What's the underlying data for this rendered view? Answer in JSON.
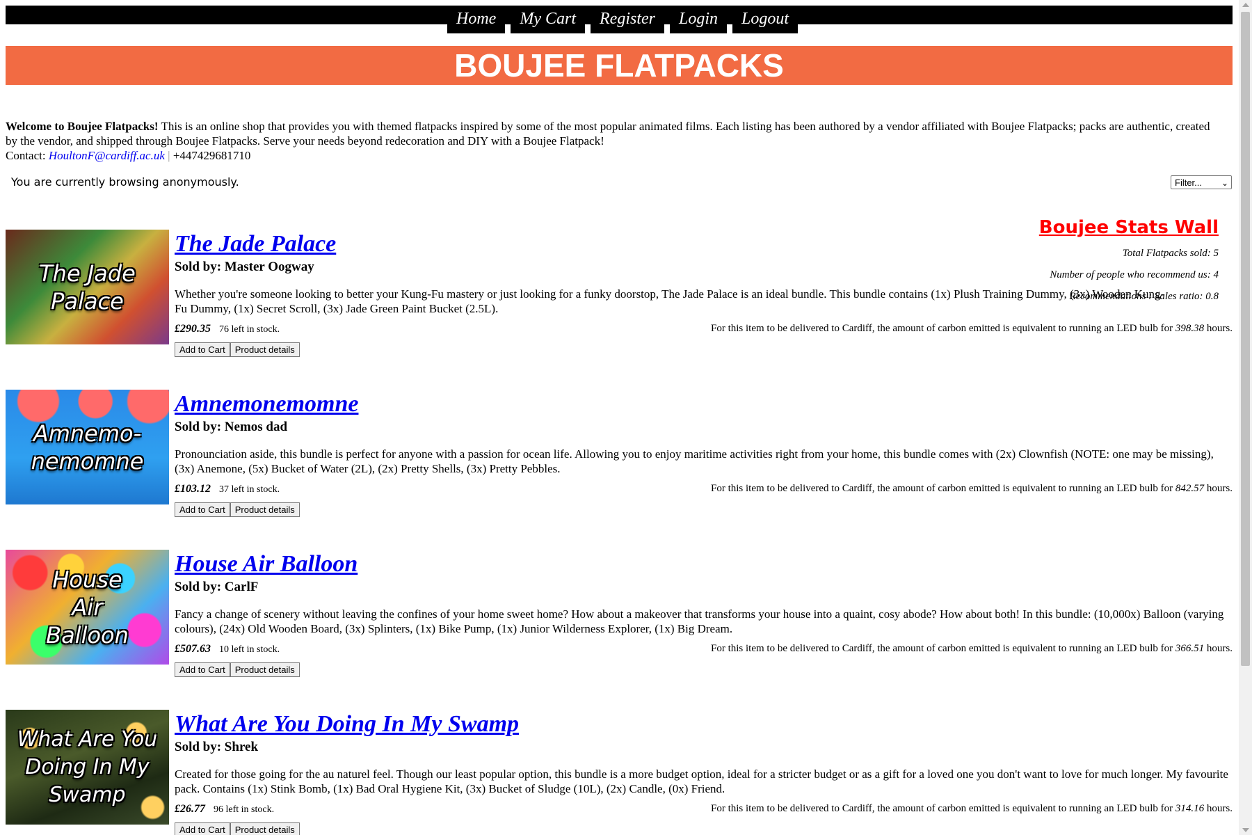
{
  "nav": {
    "items": [
      "Home",
      "My Cart",
      "Register",
      "Login",
      "Logout"
    ]
  },
  "banner": {
    "title": "BOUJEE FLATPACKS"
  },
  "intro": {
    "welcome": "Welcome to Boujee Flatpacks!",
    "text": " This is an online shop that provides you with themed flatpacks inspired by some of the most popular animated films. Each listing has been authored by a vendor affiliated with Boujee Flatpacks; packs are authentic, created by the vendor, and shipped through Boujee Flatpacks. Serve your needs beyond redecoration and DIY with a Boujee Flatpack!",
    "contact_label": "Contact: ",
    "email": "HoultonF@cardiff.ac.uk",
    "separator": " | ",
    "phone": "+447429681710"
  },
  "browsing": "You are currently browsing anonymously.",
  "filter": {
    "selected": "Filter..."
  },
  "stats": {
    "title": "Boujee Stats Wall",
    "lines": [
      "Total Flatpacks sold: 5",
      "Number of people who recommend us: 4",
      "Recommendations : Sales ratio: 0.8"
    ]
  },
  "common": {
    "carbon_prefix": "For this item to be delivered to Cardiff, the amount of carbon emitted is equivalent to running an LED bulb for ",
    "carbon_suffix": " hours.",
    "add_to_cart": "Add to Cart",
    "product_details": "Product details",
    "stock_suffix": " left in stock."
  },
  "products": [
    {
      "title": "The Jade Palace",
      "thumb_lines": [
        "The Jade",
        "Palace"
      ],
      "seller": "Sold by: Master Oogway",
      "description": "Whether you're someone looking to better your Kung-Fu mastery or just looking for a funky doorstop, The Jade Palace is an ideal bundle. This bundle contains (1x) Plush Training Dummy, (3x) Wooden Kung-Fu Dummy, (1x) Secret Scroll, (3x) Jade Green Paint Bucket (2.5L).",
      "price": "£290.35",
      "stock": "76",
      "carbon_hours": "398.38"
    },
    {
      "title": "Amnemonemomne",
      "thumb_lines": [
        "Amnemo-",
        "nemomne"
      ],
      "seller": "Sold by: Nemos dad",
      "description": "Pronounciation aside, this bundle is perfect for anyone with a passion for ocean life. Allowing you to enjoy maritime activities right from your home, this bundle comes with (2x) Clownfish (NOTE: one may be missing), (3x) Anemone, (5x) Bucket of Water (2L), (2x) Pretty Shells, (3x) Pretty Pebbles.",
      "price": "£103.12",
      "stock": "37",
      "carbon_hours": "842.57"
    },
    {
      "title": "House Air Balloon",
      "thumb_lines": [
        "House",
        "Air",
        "Balloon"
      ],
      "seller": "Sold by: CarlF",
      "description": "Fancy a change of scenery without leaving the confines of your home sweet home? How about a makeover that transforms your house into a quaint, cosy abode? How about both! In this bundle: (10,000x) Balloon (varying colours), (24x) Old Wooden Board, (3x) Splinters, (1x) Bike Pump, (1x) Junior Wilderness Explorer, (1x) Big Dream.",
      "price": "£507.63",
      "stock": "10",
      "carbon_hours": "366.51"
    },
    {
      "title": "What Are You Doing In My Swamp",
      "thumb_lines": [
        "What Are You",
        "Doing In My",
        "Swamp"
      ],
      "seller": "Sold by: Shrek",
      "description": "Created for those going for the au naturel feel. Though our least popular option, this bundle is a more budget option, ideal for a stricter budget or as a gift for a loved one you don't want to love for much longer. My favourite pack. Contains (1x) Stink Bomb, (1x) Bad Oral Hygiene Kit, (3x) Bucket of Sludge (10L), (2x) Candle, (0x) Friend.",
      "price": "£26.77",
      "stock": "96",
      "carbon_hours": "314.16"
    }
  ]
}
